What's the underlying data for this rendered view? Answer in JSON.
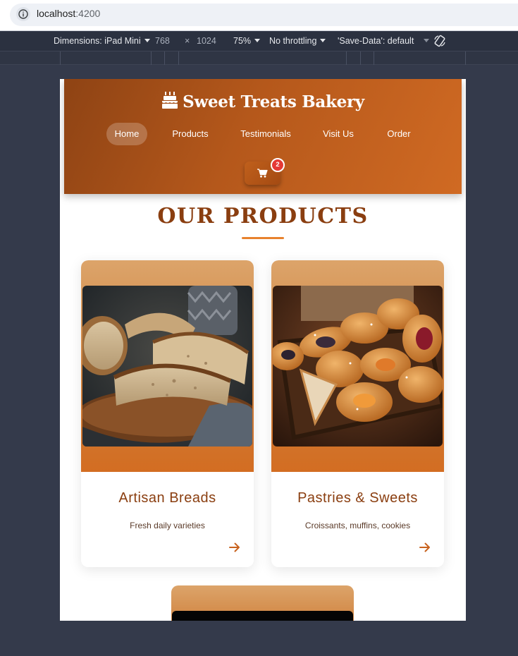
{
  "browser": {
    "url_host": "localhost",
    "url_port": ":4200"
  },
  "devtools": {
    "device_label": "Dimensions: iPad Mini",
    "width": "768",
    "times": "×",
    "height": "1024",
    "zoom": "75%",
    "throttling": "No throttling",
    "save_data": "'Save-Data': default"
  },
  "site": {
    "logo_text": "Sweet Treats Bakery",
    "nav": [
      "Home",
      "Products",
      "Testimonials",
      "Visit Us",
      "Order"
    ],
    "active_nav": "Home",
    "cart_count": "2"
  },
  "products": {
    "section_title": "OUR PRODUCTS",
    "items": [
      {
        "title": "Artisan Breads",
        "description": "Fresh daily varieties"
      },
      {
        "title": "Pastries & Sweets",
        "description": "Croissants, muffins, cookies"
      }
    ]
  },
  "colors": {
    "brand_dark": "#8e4314",
    "brand_light": "#d06a23",
    "accent": "#e8822e",
    "badge": "#e53935"
  }
}
